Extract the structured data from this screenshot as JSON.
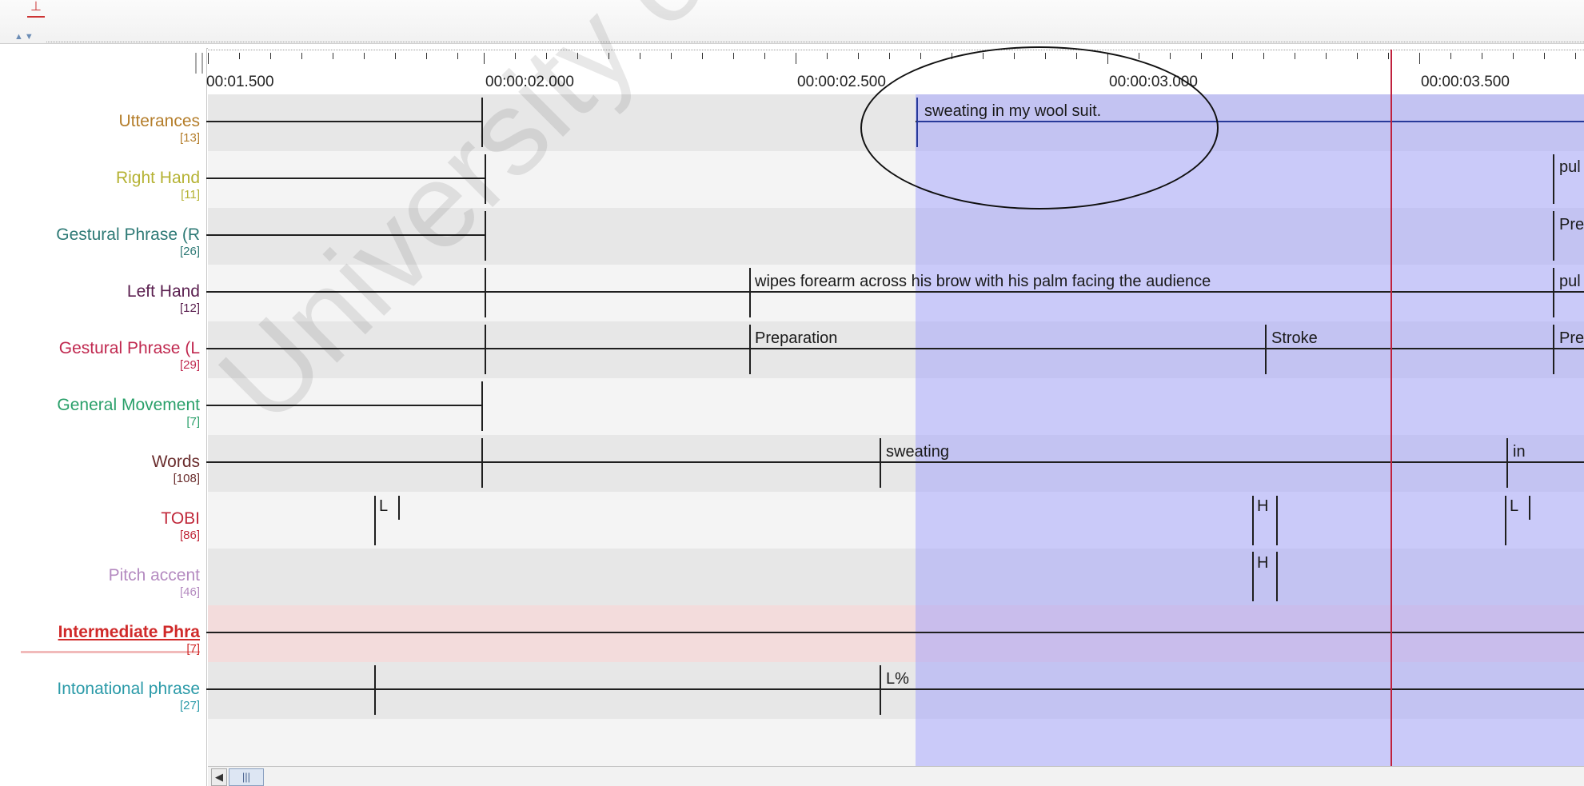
{
  "toolbar": {
    "marker_icon": "tier-marker-icon",
    "arrows": "▲▼"
  },
  "ruler": {
    "labels": [
      "00:01.500",
      "00:00:02.000",
      "00:00:02.500",
      "00:00:03.000",
      "00:00:03.500"
    ]
  },
  "tiers": [
    {
      "name": "Utterances",
      "count": "[13]",
      "color": "#b47d2a"
    },
    {
      "name": "Right Hand",
      "count": "[11]",
      "color": "#b5b233"
    },
    {
      "name": "Gestural Phrase (R",
      "count": "[26]",
      "color": "#2e7a76"
    },
    {
      "name": "Left Hand",
      "count": "[12]",
      "color": "#5a1f4f"
    },
    {
      "name": "Gestural Phrase (L",
      "count": "[29]",
      "color": "#c0284f"
    },
    {
      "name": "General Movement",
      "count": "[7]",
      "color": "#2aa06a"
    },
    {
      "name": "Words",
      "count": "[108]",
      "color": "#6a2d2d"
    },
    {
      "name": "TOBI",
      "count": "[86]",
      "color": "#c0283a"
    },
    {
      "name": "Pitch accent",
      "count": "[46]",
      "color": "#b48ac0"
    },
    {
      "name": "Intermediate Phra",
      "count": "[7]",
      "color": "#d02a2a"
    },
    {
      "name": "Intonational phrase",
      "count": "[27]",
      "color": "#2a9aa8"
    }
  ],
  "annotations": {
    "utterance": "sweating in my wool suit.",
    "right_hand": "pul",
    "gestural_r": "Pre",
    "left_hand_main": "wipes forearm across his brow with his palm facing the audience",
    "left_hand_next": "pul",
    "gestural_l_prep": "Preparation",
    "gestural_l_stroke": "Stroke",
    "gestural_l_next": "Pre",
    "word_1": "sweating",
    "word_2": "in",
    "tobi_1": "L",
    "tobi_2": "H",
    "tobi_3": "L",
    "pitch_1": "H",
    "intonational_1": "L%"
  },
  "watermark": "University of Malaya",
  "scroll": {
    "left_arrow": "◀",
    "thumb": "|||"
  },
  "colors": {
    "selection": "#9696ff",
    "crosshair": "#c0213d",
    "active_tier_bg": "#f3dcdc"
  }
}
